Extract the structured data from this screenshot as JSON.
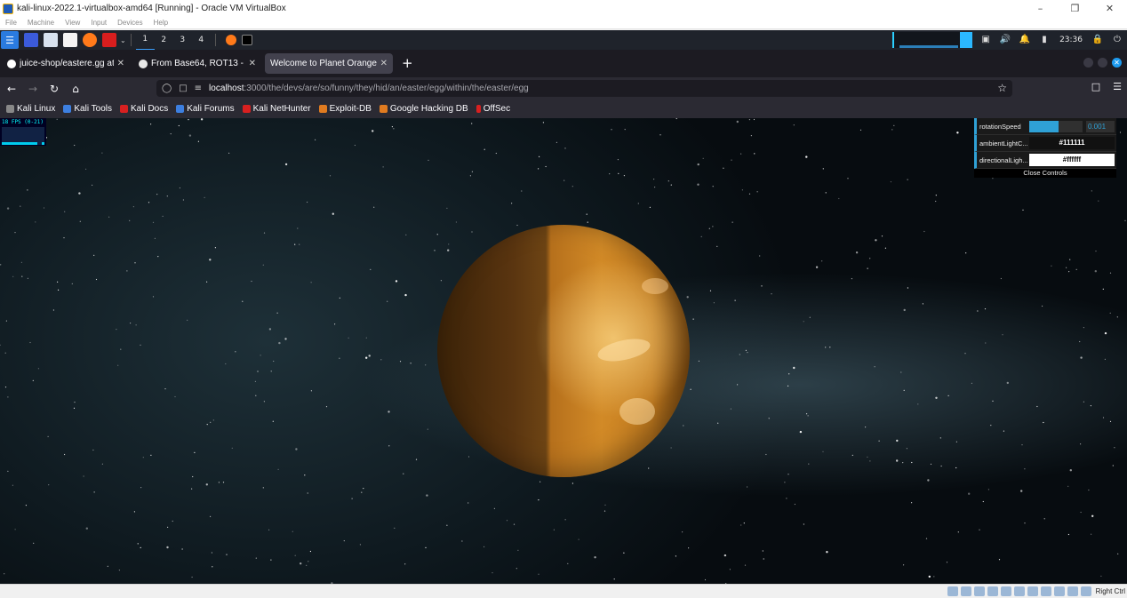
{
  "vbox": {
    "title": "kali-linux-2022.1-virtualbox-amd64 [Running] - Oracle VM VirtualBox",
    "menu": [
      "File",
      "Machine",
      "View",
      "Input",
      "Devices",
      "Help"
    ],
    "host_key": "Right Ctrl"
  },
  "kali_panel": {
    "workspaces": [
      "1",
      "2",
      "3",
      "4"
    ],
    "active_workspace": "1",
    "clock": "23:36"
  },
  "browser": {
    "tabs": [
      {
        "label": "juice-shop/eastere.gg at r",
        "active": false
      },
      {
        "label": "From Base64, ROT13 - Cy",
        "active": false
      },
      {
        "label": "Welcome to Planet Orange",
        "active": true
      }
    ],
    "url_host": "localhost",
    "url_path": ":3000/the/devs/are/so/funny/they/hid/an/easter/egg/within/the/easter/egg",
    "bookmarks": [
      "Kali Linux",
      "Kali Tools",
      "Kali Docs",
      "Kali Forums",
      "Kali NetHunter",
      "Exploit-DB",
      "Google Hacking DB",
      "OffSec"
    ]
  },
  "fps": {
    "label": "18 FPS (0-21)"
  },
  "gui": {
    "rotation_label": "rotationSpeed",
    "rotation_value": "0.001",
    "rotation_fill": 0.55,
    "ambient_label": "ambientLightC...",
    "ambient_value": "#111111",
    "ambient_color": "#111111",
    "directional_label": "directionalLigh...",
    "directional_value": "#ffffff",
    "directional_color": "#ffffff",
    "close_label": "Close Controls"
  }
}
